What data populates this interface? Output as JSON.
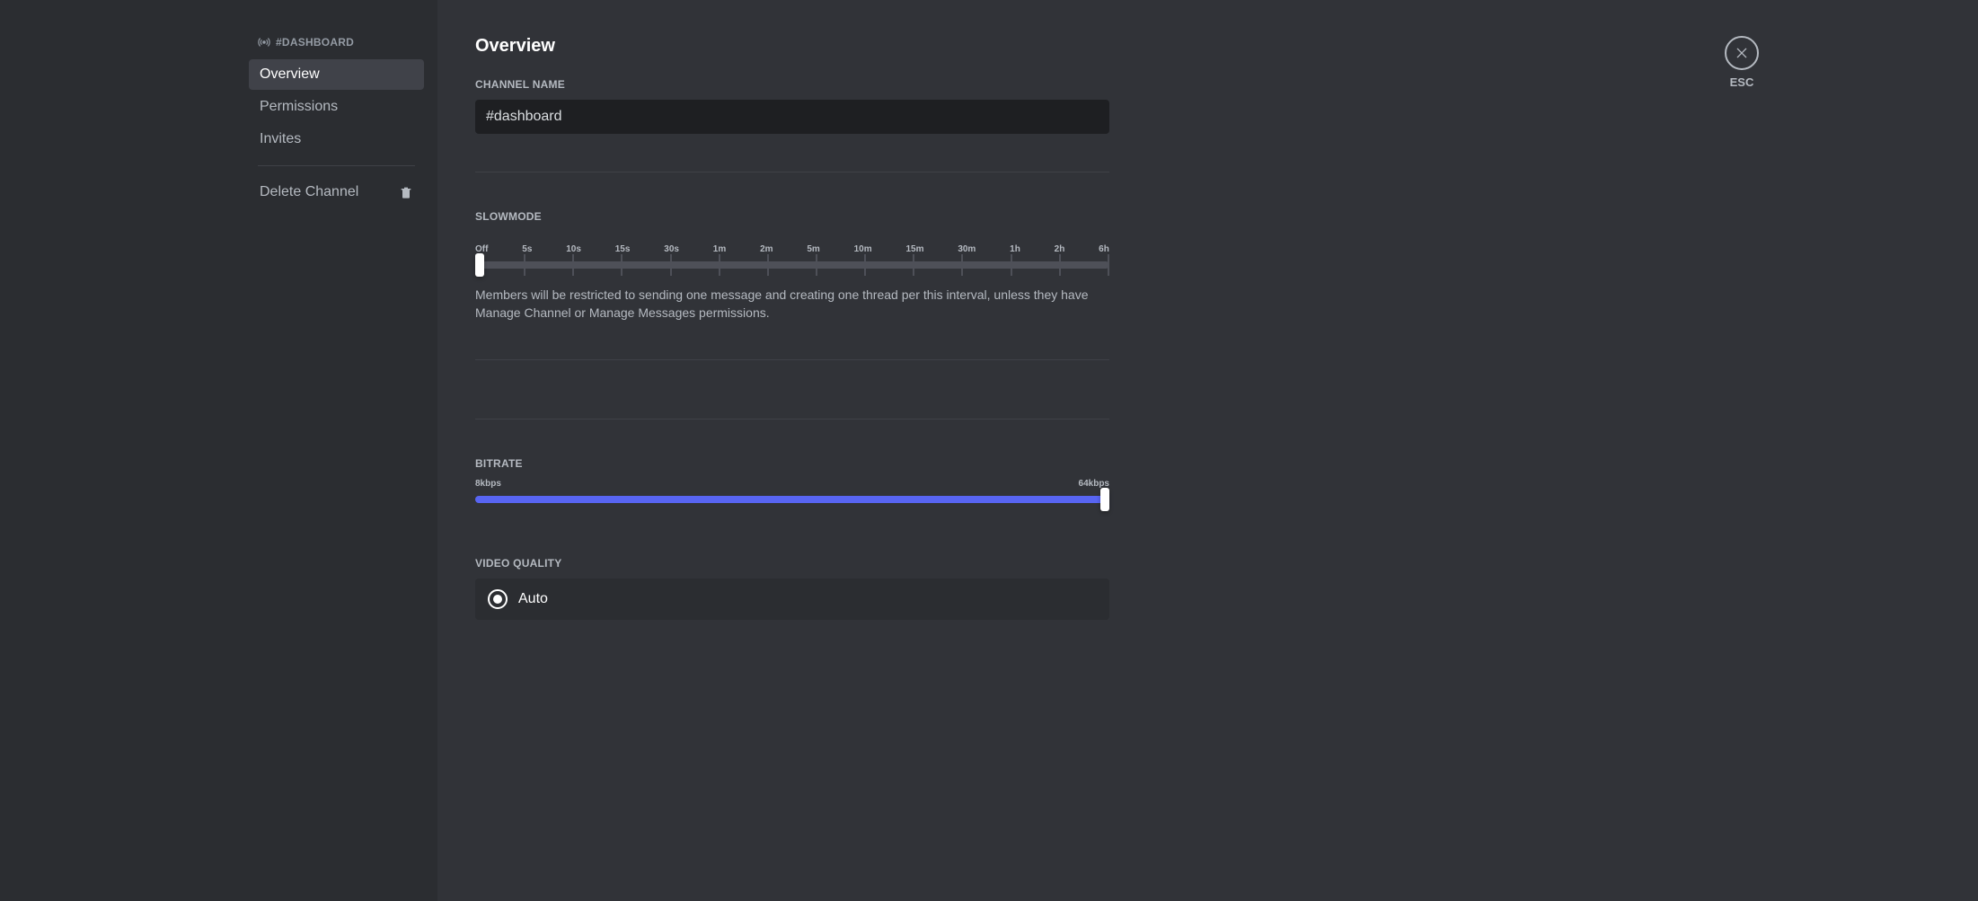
{
  "sidebar": {
    "channel_header": "#DASHBOARD",
    "items": [
      {
        "label": "Overview",
        "active": true
      },
      {
        "label": "Permissions",
        "active": false
      },
      {
        "label": "Invites",
        "active": false
      }
    ],
    "delete_label": "Delete Channel"
  },
  "close": {
    "label": "ESC"
  },
  "page": {
    "title": "Overview"
  },
  "channel_name": {
    "label": "Channel Name",
    "value": "#dashboard"
  },
  "slowmode": {
    "label": "Slowmode",
    "ticks": [
      "Off",
      "5s",
      "10s",
      "15s",
      "30s",
      "1m",
      "2m",
      "5m",
      "10m",
      "15m",
      "30m",
      "1h",
      "2h",
      "6h"
    ],
    "description": "Members will be restricted to sending one message and creating one thread per this interval, unless they have Manage Channel or Manage Messages permissions."
  },
  "bitrate": {
    "label": "Bitrate",
    "min_label": "8kbps",
    "max_label": "64kbps"
  },
  "video_quality": {
    "label": "Video Quality",
    "options": [
      {
        "label": "Auto",
        "checked": true
      }
    ]
  }
}
